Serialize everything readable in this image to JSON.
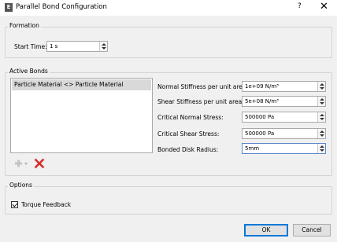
{
  "window": {
    "title": "Parallel Bond Configuration",
    "help": "?",
    "close": "✕"
  },
  "formation": {
    "group_title": "Formation",
    "start_time_label": "Start Time:",
    "start_time_value": "1 s"
  },
  "active_bonds": {
    "group_title": "Active Bonds",
    "list_items": [
      "Particle Material <> Particle Material"
    ],
    "fields": [
      {
        "label": "Normal Stiffness per unit area:",
        "value": "1e+09 N/m³"
      },
      {
        "label": "Shear Stiffness per unit area:",
        "value": "5e+08 N/m³"
      },
      {
        "label": "Critical Normal Stress:",
        "value": "500000 Pa"
      },
      {
        "label": "Critical Shear Stress:",
        "value": "500000 Pa"
      },
      {
        "label": "Bonded Disk Radius:",
        "value": "5mm"
      }
    ],
    "add_icon": "plus-icon",
    "remove_icon": "red-x-icon"
  },
  "options": {
    "group_title": "Options",
    "torque_feedback_label": "Torque Feedback",
    "torque_feedback_checked": true
  },
  "buttons": {
    "ok": "OK",
    "cancel": "Cancel"
  },
  "colors": {
    "remove_icon": "#d32f2f",
    "focus_border": "#5a87c8",
    "default_button_border": "#0078d7"
  }
}
